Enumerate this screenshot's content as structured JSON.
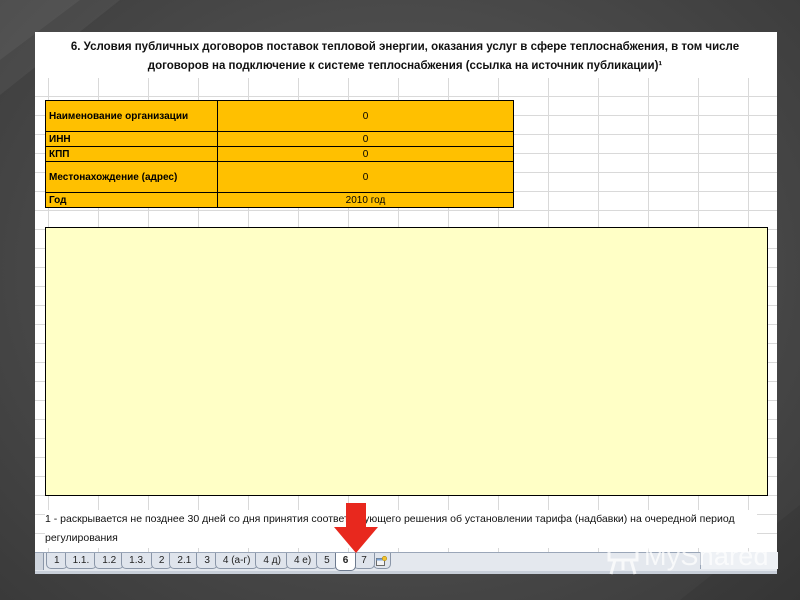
{
  "title": "6. Условия публичных договоров поставок тепловой энергии, оказания услуг в сфере теплоснабжения, в том числе договоров на подключение к системе теплоснабжения (ссылка на источник публикации)¹",
  "info_table": [
    {
      "label": "Наименование организации",
      "value": "0"
    },
    {
      "label": "ИНН",
      "value": "0"
    },
    {
      "label": "КПП",
      "value": "0"
    },
    {
      "label": "Местонахождение (адрес)",
      "value": "0"
    },
    {
      "label": "Год",
      "value": "2010 год"
    }
  ],
  "footnote": "1 - раскрывается не позднее 30 дней со дня принятия соответствующего решения об установлении тарифа (надбавки) на очередной период регулирования",
  "tabs": [
    "1",
    "1.1.",
    "1.2",
    "1.3.",
    "2",
    "2.1",
    "3",
    "4 (а-г)",
    "4 д)",
    "4 е)",
    "5",
    "6",
    "7"
  ],
  "active_tab": "6",
  "logo": {
    "text": "MyShared",
    "icon": "presentation-board-icon"
  },
  "colors": {
    "cell_fill": "#ffc000",
    "content_fill": "#ffffc6",
    "arrow": "#e8281e"
  }
}
